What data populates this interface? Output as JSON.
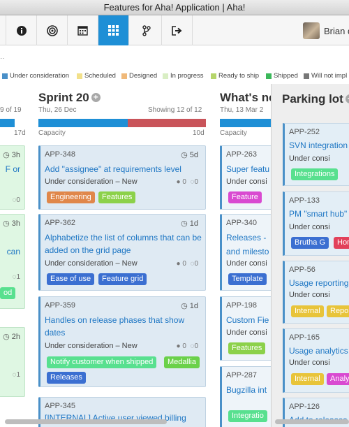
{
  "window": {
    "title": "Features for Aha! Application | Aha!"
  },
  "toolbar": {
    "buttons": [
      {
        "name": "info-icon"
      },
      {
        "name": "target-icon"
      },
      {
        "name": "calendar-icon"
      },
      {
        "name": "grid-icon"
      },
      {
        "name": "branch-icon"
      },
      {
        "name": "sign-out-icon"
      }
    ],
    "user_name": "Brian d"
  },
  "legend": [
    {
      "label": "Under consideration",
      "color": "#4a90c8"
    },
    {
      "label": "Scheduled",
      "color": "#f2e08a"
    },
    {
      "label": "Designed",
      "color": "#f0b97a"
    },
    {
      "label": "In progress",
      "color": "#d9eec4"
    },
    {
      "label": "Ready to ship",
      "color": "#b5d56a"
    },
    {
      "label": "Shipped",
      "color": "#3bb85a"
    },
    {
      "label": "Will not impl",
      "color": "#777777"
    }
  ],
  "left_col": {
    "showing": "9 of 19",
    "cap_right": "17d",
    "cards": [
      {
        "est": "3h",
        "frag": "F or"
      },
      {
        "est": "3h",
        "frag": "can"
      },
      {
        "count": "1",
        "tag": "od"
      },
      {
        "est": "2h"
      },
      {
        "count": "1"
      }
    ]
  },
  "sprint": {
    "title": "Sprint 20",
    "date": "Thu, 26 Dec",
    "showing": "Showing 12 of 12",
    "cap_label": "Capacity",
    "cap_right": "10d",
    "cards": [
      {
        "id": "APP-348",
        "est": "5d",
        "title": "Add \"assignee\" at requirements level",
        "status": "Under consideration – New",
        "todos": "0",
        "comments": "0",
        "tags": [
          {
            "label": "Engineering",
            "color": "#e0874a"
          },
          {
            "label": "Features",
            "color": "#8cd14a"
          }
        ]
      },
      {
        "id": "APP-362",
        "est": "1d",
        "title": "Alphabetize the list of columns that can be added on the grid page",
        "status": "Under consideration – New",
        "todos": "0",
        "comments": "0",
        "tags": [
          {
            "label": "Ease of use",
            "color": "#3b6fd1"
          },
          {
            "label": "Feature grid",
            "color": "#3b6fd1"
          }
        ]
      },
      {
        "id": "APP-359",
        "est": "1d",
        "title": "Handles on release phases that show dates",
        "status": "Under consideration – New",
        "todos": "0",
        "comments": "0",
        "tags": [
          {
            "label": "Notify customer when shipped",
            "color": "#58e08f"
          },
          {
            "label": "Medallia",
            "color": "#6bd14a"
          },
          {
            "label": "Releases",
            "color": "#3b6fd1"
          }
        ]
      },
      {
        "id": "APP-345",
        "title": "[INTERNAL] Active user viewed billing"
      }
    ]
  },
  "whats_next": {
    "title": "What's ne",
    "date": "Thu, 13 Mar 2",
    "cap_label": "Capacity",
    "cards": [
      {
        "id": "APP-263",
        "title": "Super featu",
        "status": "Under consi",
        "tag": {
          "label": "Feature",
          "color": "#d94ad1"
        }
      },
      {
        "id": "APP-340",
        "title": "Releases -",
        "title2": "and milesto",
        "status": "Under consi",
        "tag": {
          "label": "Template",
          "color": "#3b6fd1"
        }
      },
      {
        "id": "APP-198",
        "title": "Custom Fie",
        "status": "Under consi",
        "tag": {
          "label": "Features",
          "color": "#8cd14a"
        }
      },
      {
        "id": "APP-287",
        "title": "Bugzilla int",
        "tag": {
          "label": "Integratio",
          "color": "#58e08f"
        }
      }
    ]
  },
  "parking_lot": {
    "title": "Parking lot",
    "cards": [
      {
        "id": "APP-252",
        "title": "SVN integration",
        "status": "Under consi",
        "tags": [
          {
            "label": "Integrations",
            "color": "#58e08f"
          }
        ]
      },
      {
        "id": "APP-133",
        "title": "PM \"smart hub\"",
        "status": "Under consi",
        "tags": [
          {
            "label": "Brutha G",
            "color": "#3b6fd1"
          },
          {
            "label": "Hom",
            "color": "#e2415a"
          }
        ]
      },
      {
        "id": "APP-56",
        "title": "Usage reporting",
        "status": "Under consi",
        "tags": [
          {
            "label": "Internal",
            "color": "#e8c43a"
          },
          {
            "label": "Repo",
            "color": "#e8c43a"
          }
        ]
      },
      {
        "id": "APP-165",
        "title": "Usage analytics -",
        "status": "Under consi",
        "tags": [
          {
            "label": "Internal",
            "color": "#e8c43a"
          },
          {
            "label": "Analy",
            "color": "#d94ad1"
          }
        ]
      },
      {
        "id": "APP-126",
        "title": "Add to releases"
      }
    ]
  }
}
